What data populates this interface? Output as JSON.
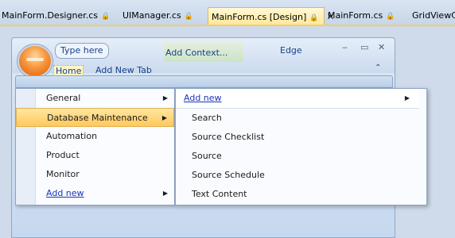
{
  "doc_tabs": [
    {
      "label": "MainForm.Designer.cs",
      "locked": true
    },
    {
      "label": "UIManager.cs",
      "locked": true
    },
    {
      "label": "MainForm.cs [Design]",
      "locked": true,
      "active": true
    },
    {
      "label": "MainForm.cs",
      "locked": true
    },
    {
      "label": "GridViewClip",
      "locked": false
    }
  ],
  "icons": {
    "lock": "🔒",
    "close": "✕",
    "arrow": "▶",
    "minimize": "‒",
    "maximize": "▭",
    "window_close": "✕",
    "collapse": "⌃"
  },
  "form": {
    "type_here": "Type here",
    "add_context": "Add Context...",
    "edge": "Edge",
    "ribbon_tabs": {
      "home": "Home",
      "add_new": "Add New Tab"
    }
  },
  "menu": {
    "items": [
      {
        "label": "General",
        "has_submenu": true
      },
      {
        "label": "Database Maintenance",
        "has_submenu": true,
        "highlighted": true
      },
      {
        "label": "Automation"
      },
      {
        "label": "Product"
      },
      {
        "label": "Monitor"
      },
      {
        "label": "Add new",
        "has_submenu": true,
        "link": true
      }
    ]
  },
  "submenu": {
    "header": "Add new",
    "items": [
      "Search",
      "Source Checklist",
      "Source",
      "Source Schedule",
      "Text Content"
    ]
  },
  "colors": {
    "highlight": "#ffc85b",
    "link": "#1a35b8",
    "active_tab": "#ffe79c"
  }
}
